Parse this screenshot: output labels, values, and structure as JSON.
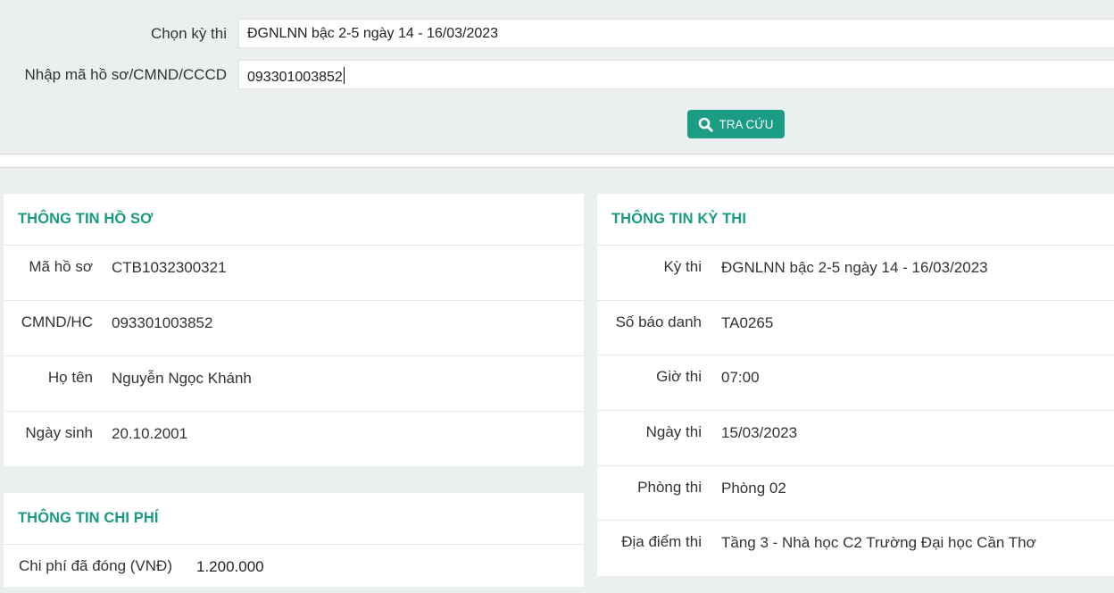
{
  "search": {
    "exam_label": "Chọn kỳ thi",
    "exam_value": "ĐGNLNN bậc 2-5 ngày 14 - 16/03/2023",
    "id_label": "Nhập mã hồ sơ/CMND/CCCD",
    "id_value": "093301003852",
    "button_label": "TRA CỨU",
    "button_icon": "search-icon"
  },
  "profile": {
    "title": "THÔNG TIN HỒ SƠ",
    "rows": [
      {
        "label": "Mã hồ sơ",
        "value": "CTB1032300321"
      },
      {
        "label": "CMND/HC",
        "value": "093301003852"
      },
      {
        "label": "Họ tên",
        "value": "Nguyễn Ngọc Khánh"
      },
      {
        "label": "Ngày sinh",
        "value": "20.10.2001"
      }
    ]
  },
  "fee": {
    "title": "THÔNG TIN CHI PHÍ",
    "label": "Chi phí đã đóng (VNĐ)",
    "value": "1.200.000"
  },
  "exam": {
    "title": "THÔNG TIN KỲ THI",
    "rows": [
      {
        "label": "Kỳ thi",
        "value": "ĐGNLNN bậc 2-5 ngày 14 - 16/03/2023"
      },
      {
        "label": "Số báo danh",
        "value": "TA0265"
      },
      {
        "label": "Giờ thi",
        "value": "07:00"
      },
      {
        "label": "Ngày thi",
        "value": "15/03/2023"
      },
      {
        "label": "Phòng thi",
        "value": "Phòng 02"
      },
      {
        "label": "Địa điểm thi",
        "value": "Tầng 3 - Nhà học C2 Trường Đại học Cần Thơ"
      }
    ]
  },
  "colors": {
    "accent": "#1a9c85",
    "page_bg": "#ebeff0",
    "heading": "#1a9a82"
  }
}
